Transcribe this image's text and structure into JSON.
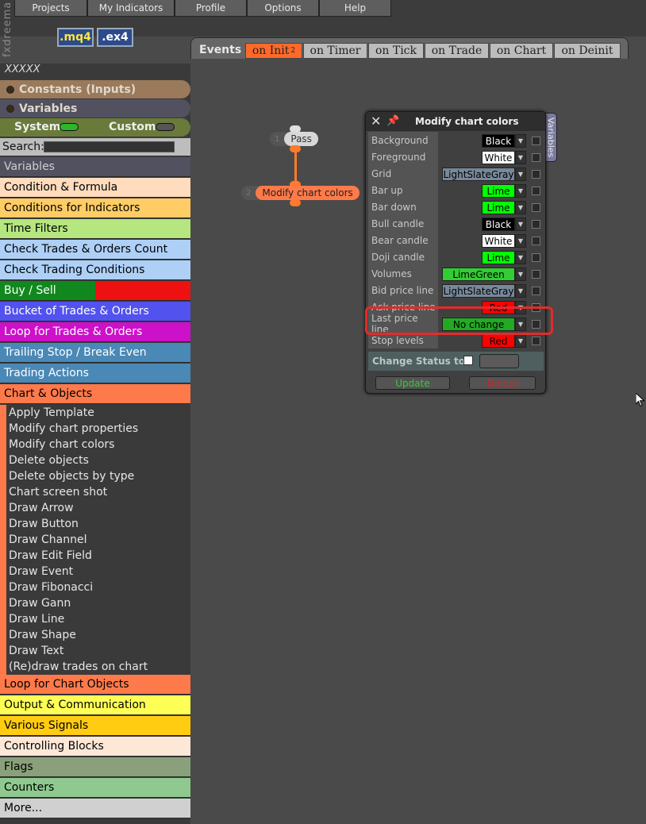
{
  "brand": "fxdreema",
  "menu": [
    {
      "label": "Projects",
      "name": "menu-projects"
    },
    {
      "label": "My Indicators",
      "name": "menu-my-indicators"
    },
    {
      "label": "Profile",
      "name": "menu-profile"
    },
    {
      "label": "Options",
      "name": "menu-options"
    },
    {
      "label": "Help",
      "name": "menu-help"
    }
  ],
  "files": {
    "mq4": ".mq4",
    "ex4": ".ex4"
  },
  "events": {
    "label": "Events",
    "tabs": [
      {
        "label": "on Init",
        "badge": "2",
        "active": true
      },
      {
        "label": "on Timer",
        "active": false
      },
      {
        "label": "on Tick",
        "active": false
      },
      {
        "label": "on Trade",
        "active": false
      },
      {
        "label": "on Chart",
        "active": false
      },
      {
        "label": "on Deinit",
        "active": false
      }
    ]
  },
  "sidebar": {
    "title": "XXXXX",
    "constants": "Constants (Inputs)",
    "variables_pill": "Variables",
    "toggle_system": "System",
    "toggle_custom": "Custom",
    "search_label": "Search:",
    "search_value": "",
    "categories_top": [
      {
        "label": "Variables",
        "bg": "#515160",
        "fg": "#cfcfcf"
      },
      {
        "label": "Condition & Formula",
        "bg": "#fedcbd",
        "fg": "#000000"
      },
      {
        "label": "Conditions for Indicators",
        "bg": "#ffcc66",
        "fg": "#000000"
      },
      {
        "label": "Time Filters",
        "bg": "#b5e67f",
        "fg": "#000000"
      },
      {
        "label": "Check Trades & Orders Count",
        "bg": "#aed0f7",
        "fg": "#000000"
      },
      {
        "label": "Check Trading Conditions",
        "bg": "#aed0f7",
        "fg": "#000000"
      }
    ],
    "buy_sell": "Buy / Sell",
    "categories_mid": [
      {
        "label": "Bucket of Trades & Orders",
        "bg": "#5252ee",
        "fg": "#ffffff"
      },
      {
        "label": "Loop for Trades & Orders",
        "bg": "#cc11c9",
        "fg": "#ffffff"
      },
      {
        "label": "Trailing Stop / Break Even",
        "bg": "#4a88b6",
        "fg": "#ffffff"
      },
      {
        "label": "Trading Actions",
        "bg": "#4a88b6",
        "fg": "#ffffff"
      },
      {
        "label": "Chart & Objects",
        "bg": "#ff7a4a",
        "fg": "#000000"
      }
    ],
    "chart_objects_items": [
      "Apply Template",
      "Modify chart properties",
      "Modify chart colors",
      "Delete objects",
      "Delete objects by type",
      "Chart screen shot",
      "Draw Arrow",
      "Draw Button",
      "Draw Channel",
      "Draw Edit Field",
      "Draw Event",
      "Draw Fibonacci",
      "Draw Gann",
      "Draw Line",
      "Draw Shape",
      "Draw Text",
      "(Re)draw trades on chart"
    ],
    "categories_bottom": [
      {
        "label": "Loop for Chart Objects",
        "bg": "#ff7a4a",
        "fg": "#000000"
      },
      {
        "label": "Output & Communication",
        "bg": "#ffff55",
        "fg": "#000000"
      },
      {
        "label": "Various Signals",
        "bg": "#ffcc11",
        "fg": "#000000"
      },
      {
        "label": "Controlling Blocks",
        "bg": "#fde8d8",
        "fg": "#000000"
      },
      {
        "label": "Flags",
        "bg": "#8aa07a",
        "fg": "#000000"
      },
      {
        "label": "Counters",
        "bg": "#8fc98f",
        "fg": "#000000"
      },
      {
        "label": "More...",
        "bg": "#d0d0d0",
        "fg": "#000000"
      }
    ]
  },
  "nodes": [
    {
      "num": "1",
      "label": "Pass"
    },
    {
      "num": "2",
      "label": "Modify chart colors"
    }
  ],
  "dialog": {
    "title": "Modify chart colors",
    "side_tab": "Variables",
    "rows": [
      {
        "label": "Background",
        "value": "Black",
        "bg": "#000000",
        "fg": "#ffffff",
        "wide": false
      },
      {
        "label": "Foreground",
        "value": "White",
        "bg": "#ffffff",
        "fg": "#000000",
        "wide": false
      },
      {
        "label": "Grid",
        "value": "LightSlateGray",
        "bg": "#778899",
        "fg": "#000000",
        "wide": true
      },
      {
        "label": "Bar up",
        "value": "Lime",
        "bg": "#00ff00",
        "fg": "#000000",
        "wide": false
      },
      {
        "label": "Bar down",
        "value": "Lime",
        "bg": "#00ff00",
        "fg": "#000000",
        "wide": false
      },
      {
        "label": "Bull candle",
        "value": "Black",
        "bg": "#000000",
        "fg": "#ffffff",
        "wide": false
      },
      {
        "label": "Bear candle",
        "value": "White",
        "bg": "#ffffff",
        "fg": "#000000",
        "wide": false
      },
      {
        "label": "Doji candle",
        "value": "Lime",
        "bg": "#00ff00",
        "fg": "#000000",
        "wide": false
      },
      {
        "label": "Volumes",
        "value": "LimeGreen",
        "bg": "#32cd32",
        "fg": "#000000",
        "wide": true
      },
      {
        "label": "Bid price line",
        "value": "LightSlateGray",
        "bg": "#778899",
        "fg": "#000000",
        "wide": true
      },
      {
        "label": "Ask price line",
        "value": "Red",
        "bg": "#ff0000",
        "fg": "#000000",
        "wide": false
      },
      {
        "label": "Last price line",
        "value": "No change",
        "bg": "#22aa22",
        "fg": "#000000",
        "wide": true
      },
      {
        "label": "Stop levels",
        "value": "Red",
        "bg": "#ff0000",
        "fg": "#000000",
        "wide": false
      }
    ],
    "change_status": "Change Status to",
    "update": "Update",
    "delete": "Delete"
  },
  "colors": {
    "accent": "#ff6a2a",
    "highlight": "#e52a2a",
    "update_text": "#33cc33",
    "delete_text": "#dd2222"
  }
}
